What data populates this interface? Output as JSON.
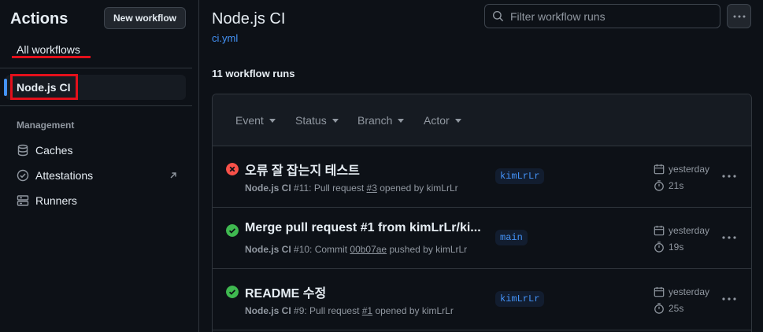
{
  "sidebar": {
    "title": "Actions",
    "new_workflow_label": "New workflow",
    "all_workflows_label": "All workflows",
    "workflows": [
      {
        "label": "Node.js CI"
      }
    ],
    "management_label": "Management",
    "management_items": [
      {
        "label": "Caches",
        "icon": "database-icon"
      },
      {
        "label": "Attestations",
        "icon": "check-circle-icon"
      },
      {
        "label": "Runners",
        "icon": "server-icon"
      }
    ]
  },
  "main": {
    "title": "Node.js CI",
    "file_link": "ci.yml",
    "search_placeholder": "Filter workflow runs",
    "run_count": "11 workflow runs",
    "filters": [
      "Event",
      "Status",
      "Branch",
      "Actor"
    ],
    "runs": [
      {
        "status": "failure",
        "title": "오류 잘 잡는지 테스트",
        "workflow": "Node.js CI",
        "meta_prefix": " #11: Pull request ",
        "meta_link": "#3",
        "meta_suffix": " opened by kimLrLr",
        "branch": "kimLrLr",
        "when": "yesterday",
        "duration": "21s"
      },
      {
        "status": "success",
        "title": "Merge pull request #1 from kimLrLr/ki...",
        "workflow": "Node.js CI",
        "meta_prefix": " #10: Commit ",
        "meta_link": "00b07ae",
        "meta_suffix": " pushed by kimLrLr",
        "branch": "main",
        "when": "yesterday",
        "duration": "19s"
      },
      {
        "status": "success",
        "title": "README 수정",
        "workflow": "Node.js CI",
        "meta_prefix": " #9: Pull request ",
        "meta_link": "#1",
        "meta_suffix": " opened by kimLrLr",
        "branch": "kimLrLr",
        "when": "yesterday",
        "duration": "25s"
      }
    ]
  },
  "colors": {
    "background": "#0d1117",
    "accent": "#4493f8",
    "success": "#3fb950",
    "failure": "#f85149",
    "annotation_red": "#e3101b"
  }
}
